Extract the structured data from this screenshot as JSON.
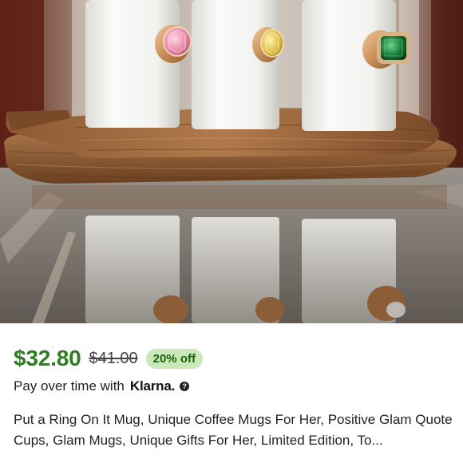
{
  "product": {
    "image_alt": "Three white mugs with jeweled ring handles on wooden tray",
    "price": "$32.80",
    "original_price": "$41.00",
    "discount_badge": "20% off",
    "pay_over_time_text": "Pay over time with",
    "klarna_label": "Klarna.",
    "title": "Put a Ring On It Mug, Unique Coffee Mugs For Her, Positive Glam Quote Cups, Glam Mugs, Unique Gifts For Her, Limited Edition, To..."
  },
  "colors": {
    "price_green": "#2f7d22",
    "badge_bg": "#c9e9b9",
    "badge_text": "#1e5d12"
  },
  "icons": {
    "klarna_info": "question-circle-icon"
  }
}
